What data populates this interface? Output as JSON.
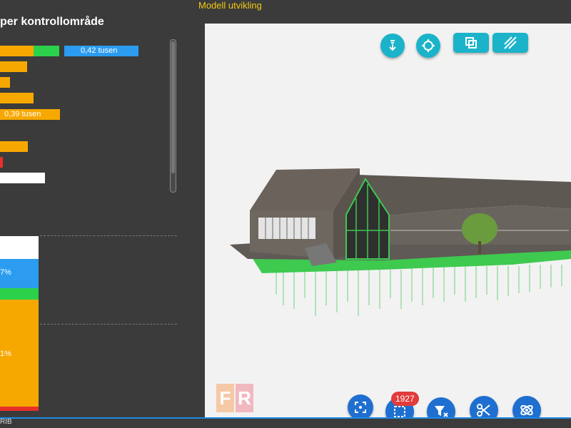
{
  "header": {
    "title": "Modell utvikling"
  },
  "left_panel": {
    "title": "per kontrollområde",
    "bar_labels": {
      "row1": "0,42 tusen",
      "row5": "0,39 tusen"
    },
    "stack_labels": {
      "blue": "7%",
      "orange": "1%"
    },
    "bottom_label": "RIB"
  },
  "viewer": {
    "badge_count": "1927",
    "logo_letters": [
      "F",
      "R"
    ]
  },
  "colors": {
    "orange": "#f7a800",
    "green": "#2bd14a",
    "blue": "#2b9cf0",
    "red": "#e8302a",
    "white": "#ffffff",
    "teal_button": "#1bb3c9",
    "blue_button": "#1e6fd0",
    "accent_title": "#f2c811"
  },
  "icons": [
    "download-icon",
    "target-icon",
    "copy-icon",
    "hatch-icon",
    "focus-icon",
    "selection-icon",
    "filter-clear-icon",
    "scissors-icon",
    "orbit-icon"
  ]
}
